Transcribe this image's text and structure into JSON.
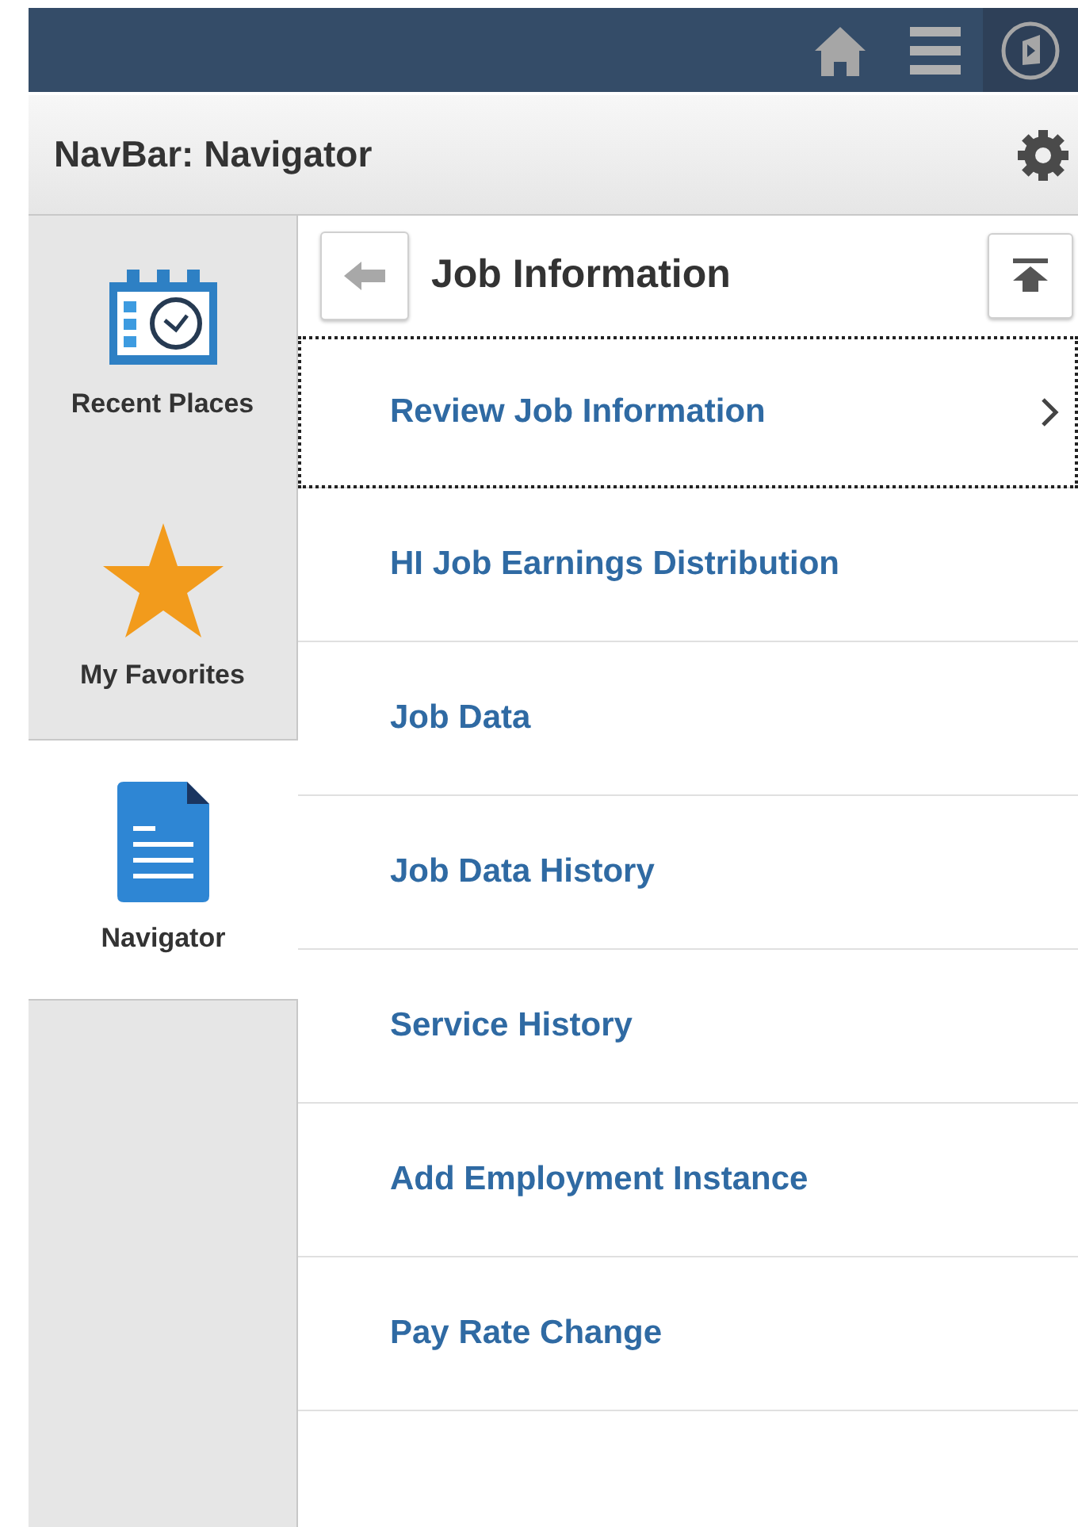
{
  "header": {
    "title": "NavBar: Navigator"
  },
  "sidebar": {
    "items": [
      {
        "label": "Recent Places",
        "kind": "recent",
        "selected": false
      },
      {
        "label": "My Favorites",
        "kind": "favorites",
        "selected": false
      },
      {
        "label": "Navigator",
        "kind": "navigator",
        "selected": true
      }
    ]
  },
  "panel": {
    "title": "Job Information",
    "items": [
      {
        "label": "Review Job Information",
        "kind": "folder",
        "focused": true
      },
      {
        "label": "HI Job Earnings Distribution",
        "kind": "link",
        "focused": false
      },
      {
        "label": "Job Data",
        "kind": "link",
        "focused": false
      },
      {
        "label": "Job Data History",
        "kind": "link",
        "focused": false
      },
      {
        "label": "Service History",
        "kind": "link",
        "focused": false
      },
      {
        "label": "Add Employment Instance",
        "kind": "link",
        "focused": false
      },
      {
        "label": "Pay Rate Change",
        "kind": "link",
        "focused": false
      }
    ]
  }
}
